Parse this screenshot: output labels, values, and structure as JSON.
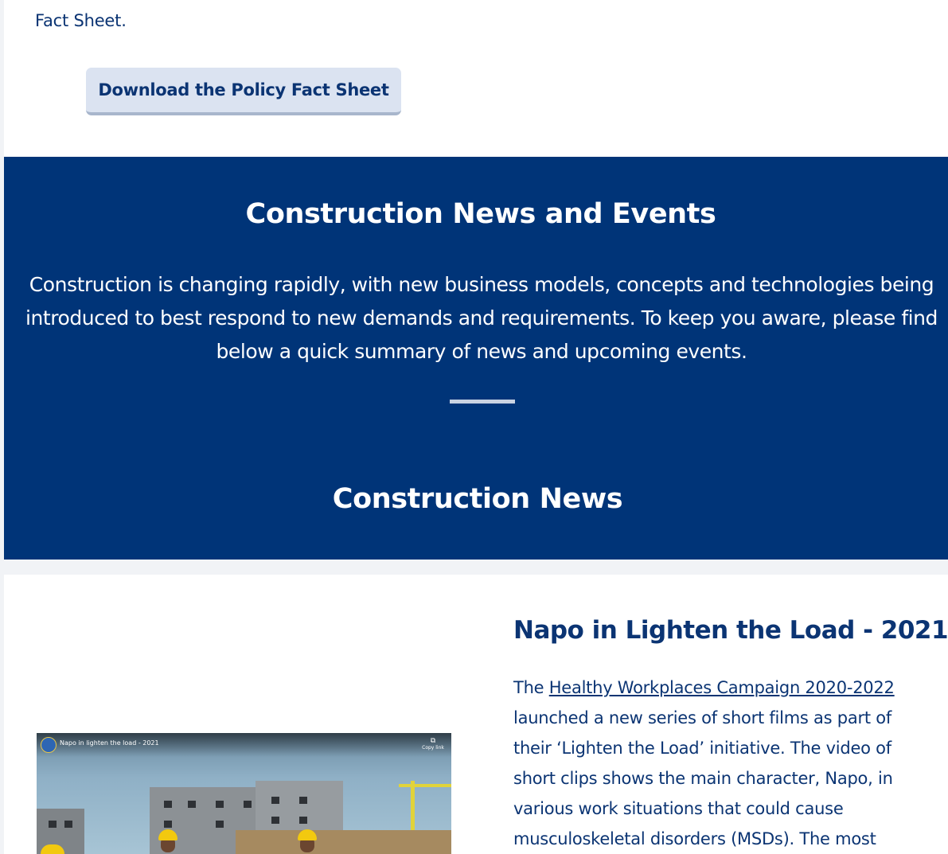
{
  "top": {
    "intro_text_tail": "Fact Sheet.",
    "download_button_label": "Download the Policy Fact Sheet"
  },
  "news_events": {
    "heading": "Construction News and Events",
    "paragraph": "Construction is changing rapidly, with new business models, concepts and technologies being introduced to best respond to new demands and requirements. To keep you aware, please find below a quick summary of news and upcoming events.",
    "subheading": "Construction News"
  },
  "article": {
    "title": "Napo in Lighten the Load - 2021",
    "body_prefix": "The ",
    "link_text": "Healthy Workplaces Campaign 2020-2022",
    "body_rest": " launched a new series of short films as part of their ‘Lighten the Load’ initiative. The video of short clips shows the main character, Napo, in various work situations that could cause musculoskeletal disorders (MSDs). The most",
    "video": {
      "title": "Napo in lighten the load - 2021",
      "copy_link_label": "Copy link"
    }
  },
  "colors": {
    "brand_blue": "#003478",
    "text_blue": "#0b3473",
    "button_bg": "#dbe3f1"
  }
}
